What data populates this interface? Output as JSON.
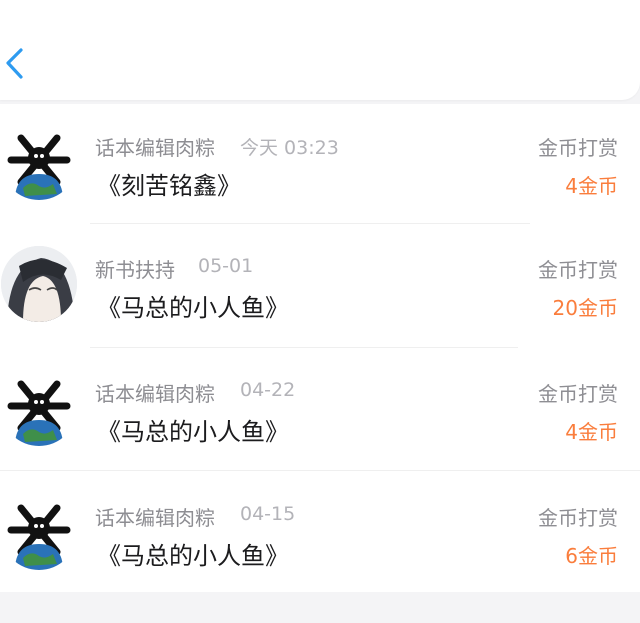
{
  "header": {
    "back_icon": "chevron-left-icon",
    "accent_color": "#2e9bf0"
  },
  "rewards": [
    {
      "avatar": "skull-globe-avatar",
      "name": "话本编辑肉粽",
      "time": "今天 03:23",
      "book": "《刻苦铭鑫》",
      "label": "金币打赏",
      "amount": "4金币"
    },
    {
      "avatar": "anime-portrait-avatar",
      "name": "新书扶持",
      "time": "05-01",
      "book": "《马总的小人鱼》",
      "label": "金币打赏",
      "amount": "20金币"
    },
    {
      "avatar": "skull-globe-avatar",
      "name": "话本编辑肉粽",
      "time": "04-22",
      "book": "《马总的小人鱼》",
      "label": "金币打赏",
      "amount": "4金币"
    },
    {
      "avatar": "skull-globe-avatar",
      "name": "话本编辑肉粽",
      "time": "04-15",
      "book": "《马总的小人鱼》",
      "label": "金币打赏",
      "amount": "6金币"
    }
  ],
  "colors": {
    "amount": "#fa7d3c",
    "secondary_text": "#8e8e93",
    "primary_text": "#1c1c1e"
  }
}
